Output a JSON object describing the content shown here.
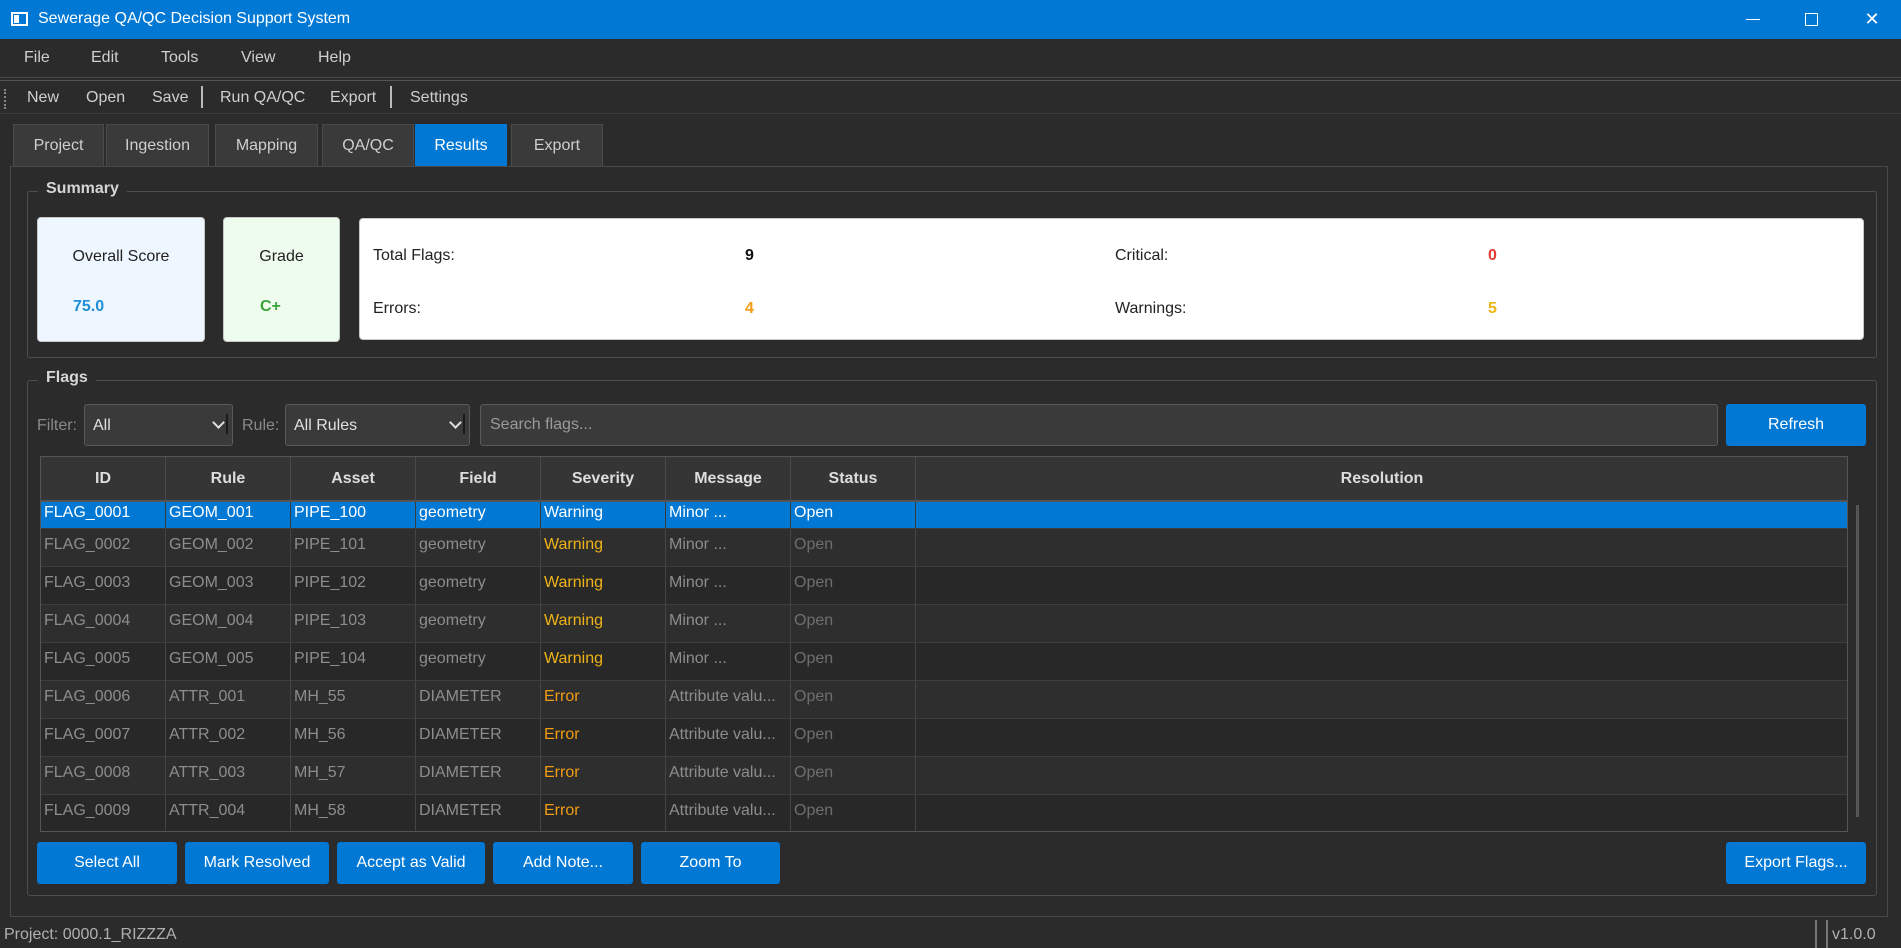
{
  "window": {
    "title": "Sewerage QA/QC Decision Support System"
  },
  "menu": [
    "File",
    "Edit",
    "Tools",
    "View",
    "Help"
  ],
  "toolbar": {
    "new": "New",
    "open": "Open",
    "save": "Save",
    "run": "Run QA/QC",
    "export": "Export",
    "settings": "Settings"
  },
  "tabs": [
    "Project",
    "Ingestion",
    "Mapping",
    "QA/QC",
    "Results",
    "Export"
  ],
  "active_tab": "Results",
  "summary": {
    "title": "Summary",
    "overall_score_label": "Overall Score",
    "overall_score": "75.0",
    "grade_label": "Grade",
    "grade": "C+",
    "total_flags_label": "Total Flags:",
    "total_flags": "9",
    "critical_label": "Critical:",
    "critical": "0",
    "errors_label": "Errors:",
    "errors": "4",
    "warnings_label": "Warnings:",
    "warnings": "5",
    "colors": {
      "score": "#1e8fd6",
      "grade": "#3aa33a",
      "critical": "#e53935",
      "errors": "#f39c12",
      "warnings": "#f0b416"
    }
  },
  "flags": {
    "title": "Flags",
    "filter_label": "Filter:",
    "filter_value": "All",
    "rule_label": "Rule:",
    "rule_value": "All Rules",
    "search_placeholder": "Search flags...",
    "refresh": "Refresh",
    "columns": [
      "ID",
      "Rule",
      "Asset",
      "Field",
      "Severity",
      "Message",
      "Status",
      "Resolution"
    ],
    "rows": [
      [
        "FLAG_0001",
        "GEOM_001",
        "PIPE_100",
        "geometry",
        "Warning",
        "Minor ...",
        "Open",
        ""
      ],
      [
        "FLAG_0002",
        "GEOM_002",
        "PIPE_101",
        "geometry",
        "Warning",
        "Minor ...",
        "Open",
        ""
      ],
      [
        "FLAG_0003",
        "GEOM_003",
        "PIPE_102",
        "geometry",
        "Warning",
        "Minor ...",
        "Open",
        ""
      ],
      [
        "FLAG_0004",
        "GEOM_004",
        "PIPE_103",
        "geometry",
        "Warning",
        "Minor ...",
        "Open",
        ""
      ],
      [
        "FLAG_0005",
        "GEOM_005",
        "PIPE_104",
        "geometry",
        "Warning",
        "Minor ...",
        "Open",
        ""
      ],
      [
        "FLAG_0006",
        "ATTR_001",
        "MH_55",
        "DIAMETER",
        "Error",
        "Attribute valu...",
        "Open",
        ""
      ],
      [
        "FLAG_0007",
        "ATTR_002",
        "MH_56",
        "DIAMETER",
        "Error",
        "Attribute valu...",
        "Open",
        ""
      ],
      [
        "FLAG_0008",
        "ATTR_003",
        "MH_57",
        "DIAMETER",
        "Error",
        "Attribute valu...",
        "Open",
        ""
      ],
      [
        "FLAG_0009",
        "ATTR_004",
        "MH_58",
        "DIAMETER",
        "Error",
        "Attribute valu...",
        "Open",
        ""
      ]
    ],
    "selected_row": 0
  },
  "actions": {
    "select_all": "Select All",
    "mark_resolved": "Mark Resolved",
    "accept_valid": "Accept as Valid",
    "add_note": "Add Note...",
    "zoom_to": "Zoom To",
    "export_flags": "Export Flags..."
  },
  "status": {
    "project": "Project: 0000.1_RIZZZA",
    "version": "v1.0.0"
  }
}
